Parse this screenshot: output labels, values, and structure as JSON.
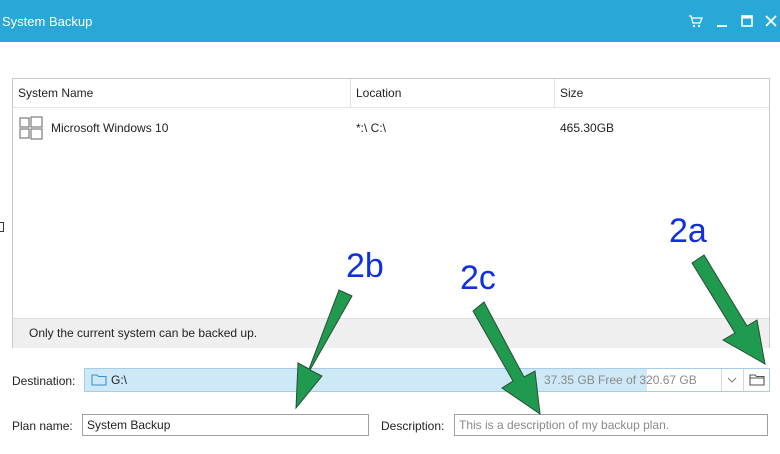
{
  "window": {
    "title": "System Backup",
    "controls": [
      "cart-icon",
      "minimize-icon",
      "maximize-icon",
      "close-icon"
    ]
  },
  "table": {
    "columns": [
      "System Name",
      "Location",
      "Size"
    ],
    "rows": [
      {
        "name": "Microsoft Windows 10",
        "location": "*:\\ C:\\",
        "size": "465.30GB",
        "icon": "windows-logo-icon"
      }
    ],
    "footer_note": "Only the current system can be backed up."
  },
  "destination": {
    "label": "Destination:",
    "path": "G:\\",
    "free_space": "37.35 GB Free of 320.67 GB"
  },
  "plan": {
    "label": "Plan name:",
    "value": "System Backup"
  },
  "description": {
    "label": "Description:",
    "placeholder": "This is a description of my backup plan."
  },
  "annotations": [
    "2a",
    "2b",
    "2c"
  ],
  "colors": {
    "titlebar": "#28a8d8",
    "arrow": "#1f9a4e",
    "annotation_text": "#1030e0",
    "destination_fill": "#cde8f7"
  }
}
